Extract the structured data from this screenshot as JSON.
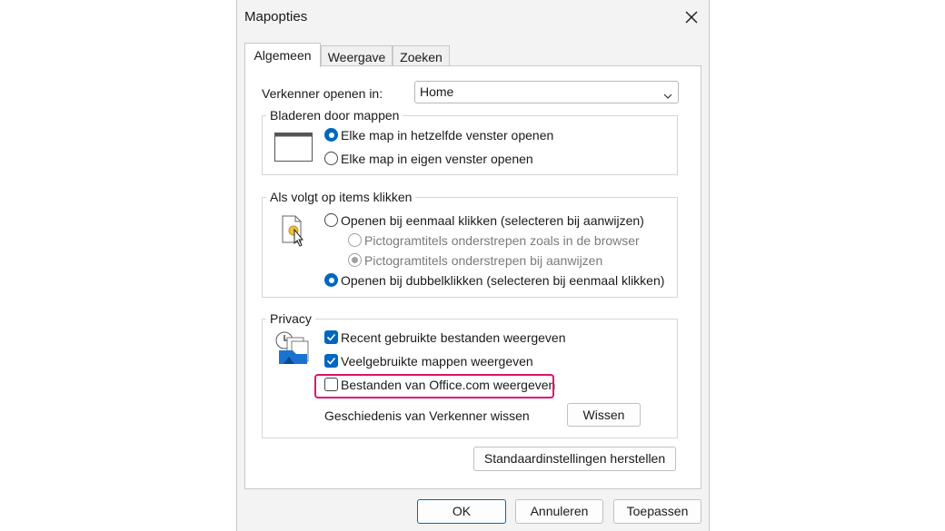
{
  "window": {
    "title": "Mapopties",
    "close_icon": "close-icon"
  },
  "tabs": [
    {
      "label": "Algemeen",
      "active": true
    },
    {
      "label": "Weergave",
      "active": false
    },
    {
      "label": "Zoeken",
      "active": false
    }
  ],
  "general": {
    "open_in_label": "Verkenner openen in:",
    "open_in_value": "Home"
  },
  "browse_group": {
    "legend": "Bladeren door mappen",
    "option_same": "Elke map in hetzelfde venster openen",
    "option_own": "Elke map in eigen venster openen",
    "selected": "same"
  },
  "click_group": {
    "legend": "Als volgt op items klikken",
    "option_single": "Openen bij eenmaal klikken (selecteren bij aanwijzen)",
    "sub_browser": "Pictogramtitels onderstrepen zoals in de browser",
    "sub_hover": "Pictogramtitels onderstrepen bij aanwijzen",
    "option_double": "Openen bij dubbelklikken (selecteren bij eenmaal klikken)",
    "selected": "double"
  },
  "privacy_group": {
    "legend": "Privacy",
    "recent_files": {
      "label": "Recent gebruikte bestanden weergeven",
      "checked": true
    },
    "frequent_folders": {
      "label": "Veelgebruikte mappen weergeven",
      "checked": true
    },
    "office_files": {
      "label": "Bestanden van Office.com weergeven",
      "checked": false
    },
    "clear_history_label": "Geschiedenis van Verkenner wissen",
    "clear_button": "Wissen"
  },
  "restore_defaults_button": "Standaardinstellingen herstellen",
  "footer": {
    "ok": "OK",
    "cancel": "Annuleren",
    "apply": "Toepassen"
  },
  "colors": {
    "accent": "#0067c0",
    "highlight": "#e0106e"
  }
}
